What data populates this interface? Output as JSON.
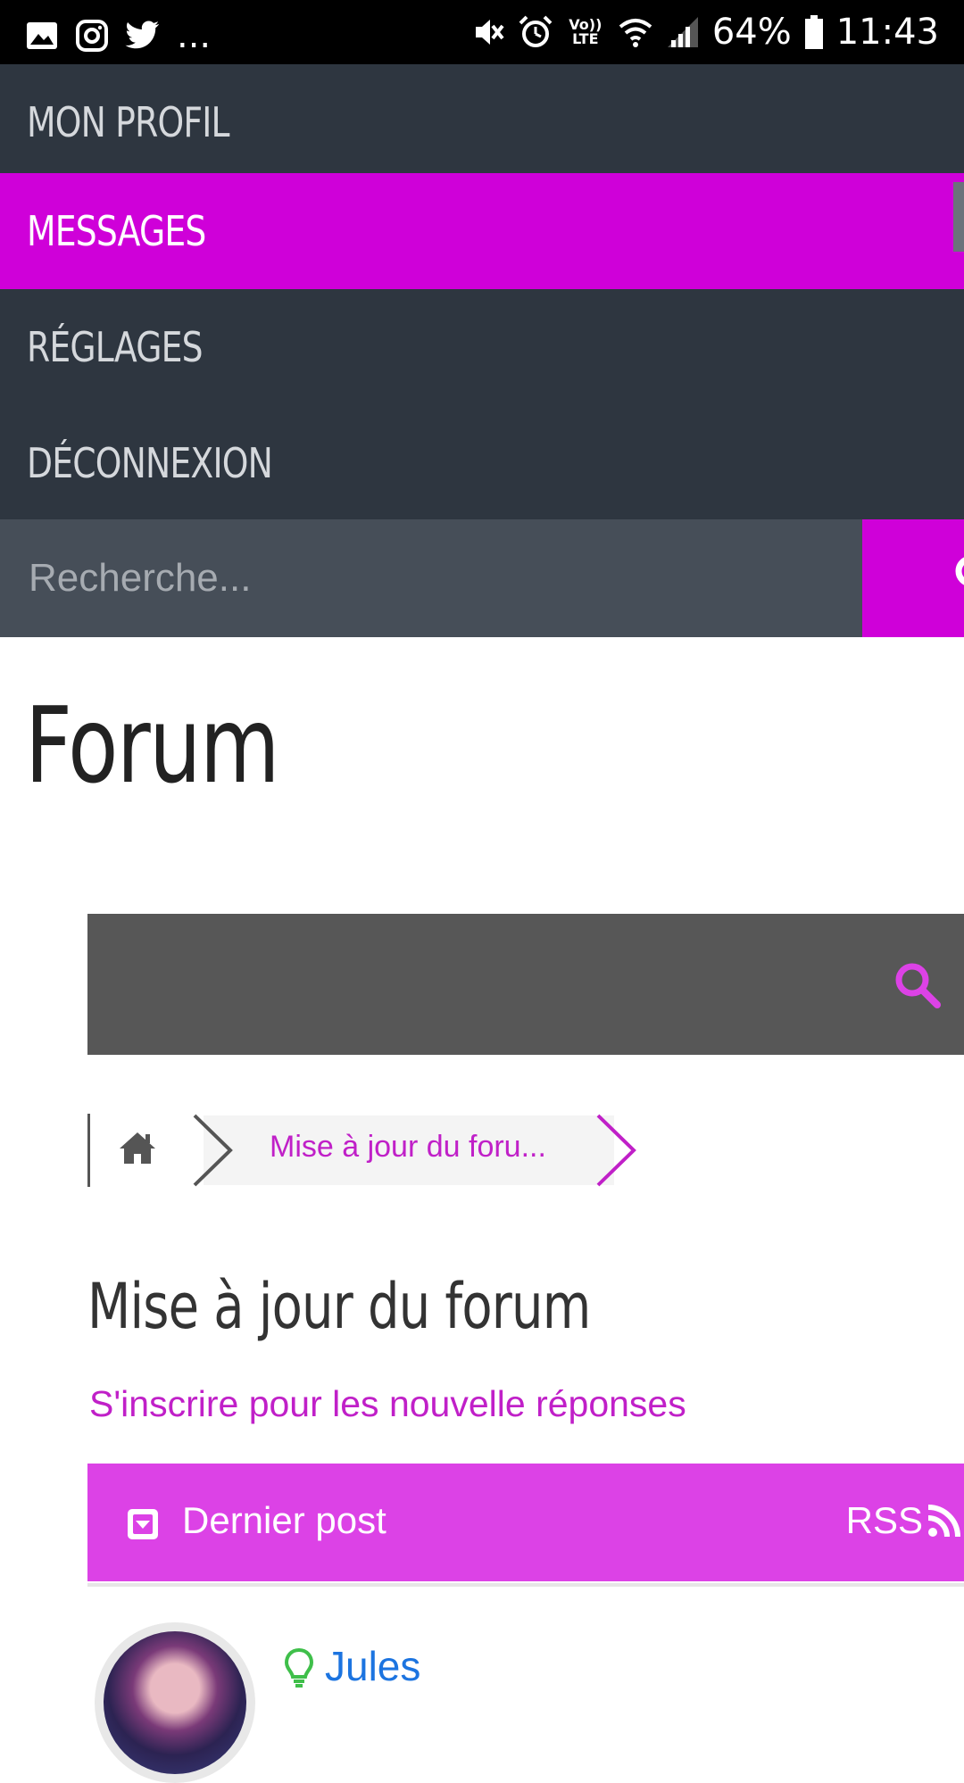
{
  "status_bar": {
    "battery": "64%",
    "time": "11:43",
    "overflow": "...",
    "volte": "Vo)) LTE"
  },
  "menu": {
    "items": [
      {
        "label": "MON PROFIL",
        "active": false
      },
      {
        "label": "MESSAGES",
        "active": true
      },
      {
        "label": "RÉGLAGES",
        "active": false
      },
      {
        "label": "DÉCONNEXION",
        "active": false
      }
    ]
  },
  "search": {
    "placeholder": "Recherche..."
  },
  "page": {
    "title": "Forum"
  },
  "breadcrumb": {
    "current": "Mise à jour du foru..."
  },
  "topic": {
    "title": "Mise à jour du forum",
    "subscribe_link": "S'inscrire pour les nouvelle réponses"
  },
  "posts_header": {
    "label": "Dernier post",
    "rss": "RSS"
  },
  "post": {
    "author": "Jules"
  },
  "colors": {
    "accent": "#cf00d9",
    "menu_bg": "#2e3640",
    "header_pink": "#dc42e6",
    "link_blue": "#1c74e0"
  },
  "icons": [
    "gallery-icon",
    "instagram-icon",
    "twitter-icon",
    "mute-icon",
    "alarm-icon",
    "wifi-icon",
    "signal-icon",
    "battery-icon",
    "search-icon",
    "home-icon",
    "chevron-right-icon",
    "dropdown-icon",
    "rss-icon",
    "bulb-icon"
  ]
}
